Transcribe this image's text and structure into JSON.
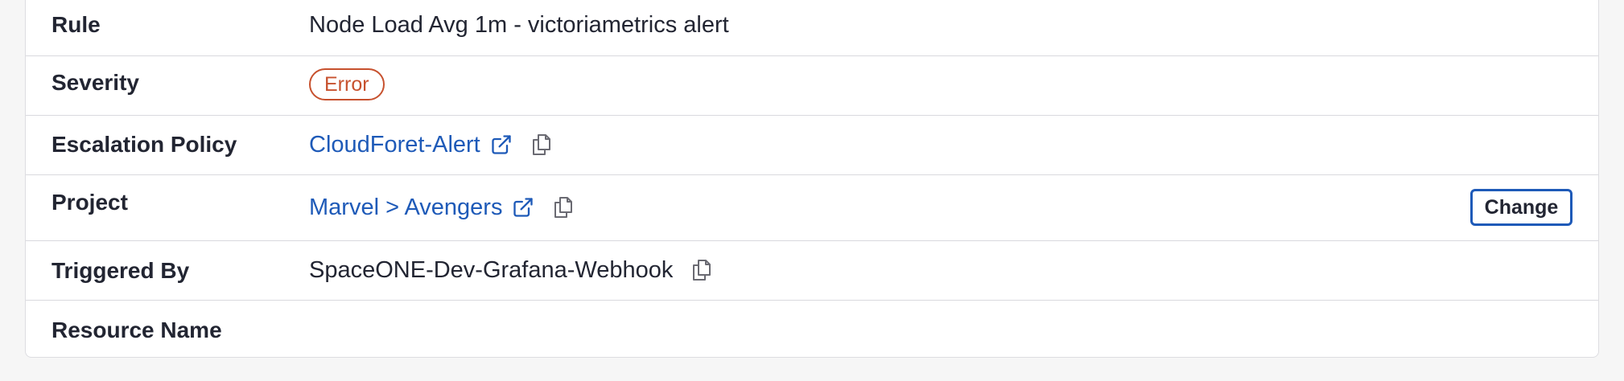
{
  "details": {
    "rule": {
      "label": "Rule",
      "value": "Node Load Avg 1m - victoriametrics alert"
    },
    "severity": {
      "label": "Severity",
      "value": "Error",
      "color": "#c7512e"
    },
    "escalation_policy": {
      "label": "Escalation Policy",
      "value": "CloudForet-Alert",
      "icons": [
        "external-link-icon",
        "copy-icon"
      ]
    },
    "project": {
      "label": "Project",
      "value": "Marvel > Avengers",
      "action_label": "Change",
      "icons": [
        "external-link-icon",
        "copy-icon"
      ]
    },
    "triggered_by": {
      "label": "Triggered By",
      "value": "SpaceONE-Dev-Grafana-Webhook",
      "icons": [
        "copy-icon"
      ]
    },
    "resource_name": {
      "label": "Resource Name",
      "value": ""
    }
  },
  "colors": {
    "link": "#1e5ab8",
    "accent_border": "#1e5ab8",
    "error": "#c7512e",
    "text": "#222532"
  }
}
